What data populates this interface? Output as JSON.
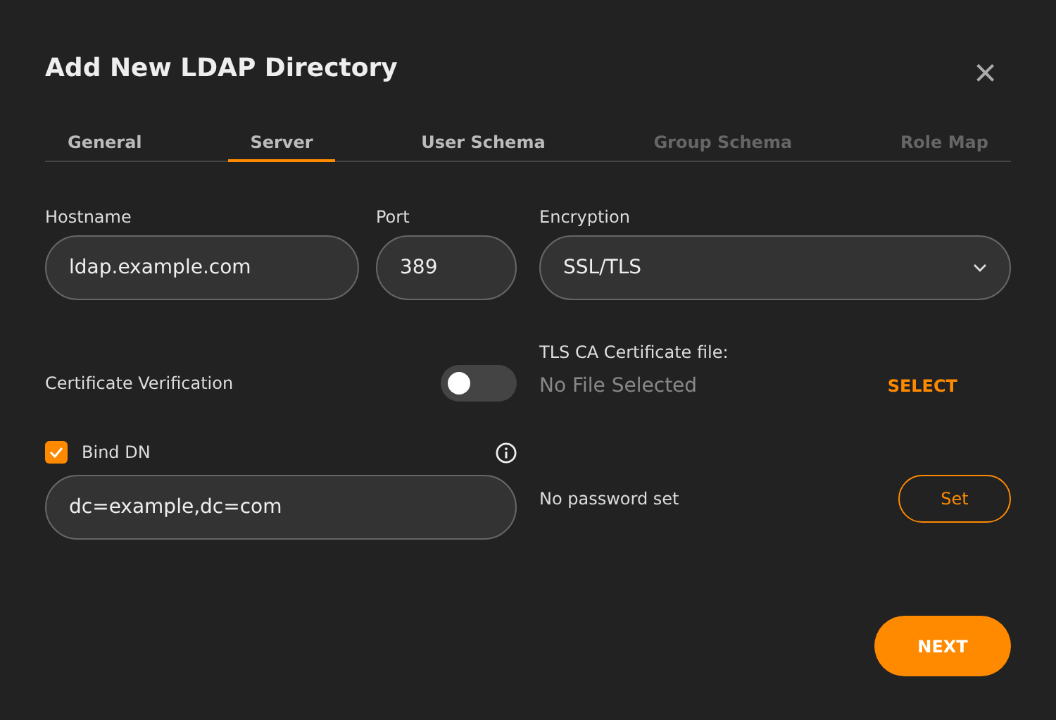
{
  "dialog": {
    "title": "Add New LDAP Directory",
    "close": "×"
  },
  "tabs": [
    {
      "label": "General",
      "selected": false,
      "disabled": false
    },
    {
      "label": "Server",
      "selected": true,
      "disabled": false
    },
    {
      "label": "User Schema",
      "selected": false,
      "disabled": false
    },
    {
      "label": "Group Schema",
      "selected": false,
      "disabled": true
    },
    {
      "label": "Role Map",
      "selected": false,
      "disabled": true
    }
  ],
  "hostname": {
    "label": "Hostname",
    "value": "ldap.example.com"
  },
  "port": {
    "label": "Port",
    "value": "389"
  },
  "encryption": {
    "label": "Encryption",
    "value": "SSL/TLS"
  },
  "certificate_verification": {
    "label": "Certificate Verification",
    "on": false
  },
  "tls_ca": {
    "label": "TLS CA Certificate file:",
    "file": "No File Selected",
    "action": "SELECT"
  },
  "bind_dn": {
    "label": "Bind DN",
    "checked": true,
    "value": "dc=example,dc=com"
  },
  "password": {
    "status": "No password set",
    "action": "Set"
  },
  "next": "NEXT"
}
